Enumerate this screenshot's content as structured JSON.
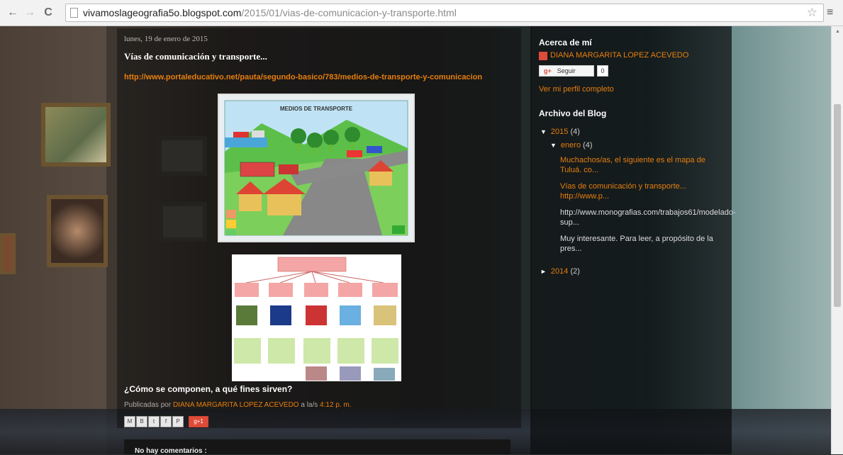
{
  "browser": {
    "url_host": "vivamoslageografia5o.blogspot.com",
    "url_path": "/2015/01/vias-de-comunicacion-y-transporte.html"
  },
  "post": {
    "date": "lunes, 19 de enero de 2015",
    "title": "Vías de comunicación y transporte...",
    "link": "http://www.portaleducativo.net/pauta/segundo-basico/783/medios-de-transporte-y-comunicacion",
    "image1_title": "MEDIOS DE TRANSPORTE",
    "subtitle": "¿Cómo se componen, a qué fines sirven?",
    "byline_prefix": "Publicadas por",
    "author": "DIANA MARGARITA LOPEZ ACEVEDO",
    "byline_mid": "a la/s",
    "time": "4:12 p. m.",
    "gplus_label": "g+1",
    "comments": "No hay comentarios :"
  },
  "sidebar": {
    "about_heading": "Acerca de mí",
    "profile_name": "DIANA MARGARITA LOPEZ ACEVEDO",
    "follow_label": "Seguir",
    "follow_count": "0",
    "view_profile": "Ver mi perfil completo",
    "archive_heading": "Archivo del Blog",
    "archive": {
      "year1": "2015",
      "year1_count": "(4)",
      "month1": "enero",
      "month1_count": "(4)",
      "posts": [
        "Muchachos/as, el siguiente es el mapa de Tuluá. co...",
        "Vías de comunicación y transporte... http://www.p...",
        "http://www.monografias.com/trabajos61/modelado-sup...",
        "Muy interesante. Para leer, a propósito de la pres..."
      ],
      "year2": "2014",
      "year2_count": "(2)"
    }
  },
  "colors": {
    "link": "#e67e0e",
    "gplus": "#dd4b39"
  }
}
